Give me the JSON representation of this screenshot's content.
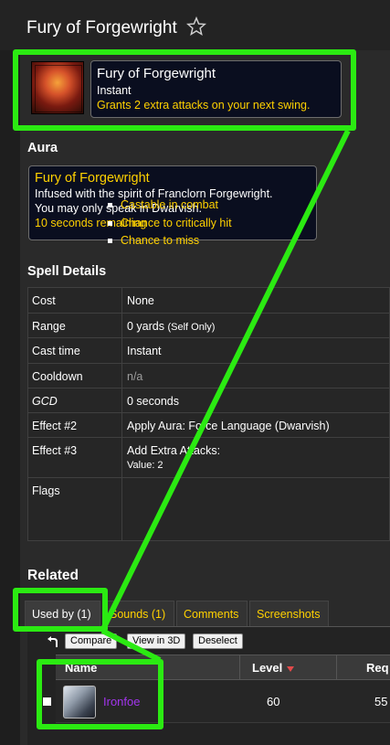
{
  "page": {
    "title": "Fury of Forgewright"
  },
  "spell_tooltip": {
    "name": "Fury of Forgewright",
    "cast": "Instant",
    "description": "Grants 2 extra attacks on your next swing."
  },
  "aura": {
    "heading": "Aura",
    "name": "Fury of Forgewright",
    "line1": "Infused with the spirit of Franclorn Forgewright.",
    "line2": "You may only speak in Dwarvish.",
    "remaining": "10 seconds remaining"
  },
  "spell_details": {
    "heading": "Spell Details",
    "rows": [
      {
        "label": "Cost",
        "value": "None"
      },
      {
        "label": "Range",
        "value": "0 yards",
        "note": "(Self Only)"
      },
      {
        "label": "Cast time",
        "value": "Instant"
      },
      {
        "label": "Cooldown",
        "value": "n/a"
      },
      {
        "label": "GCD",
        "value": "0 seconds"
      },
      {
        "label": "Effect #2",
        "value": "Apply Aura: Force Language (Dwarvish)"
      },
      {
        "label": "Effect #3",
        "value": "Add Extra Attacks:",
        "sub": "Value: 2"
      },
      {
        "label": "Flags"
      }
    ],
    "flags": [
      "Castable in combat",
      "Chance to critically hit",
      "Chance to miss"
    ]
  },
  "related": {
    "heading": "Related",
    "tabs": [
      "Used by (1)",
      "Sounds (1)",
      "Comments",
      "Screenshots"
    ],
    "toolbar": [
      "Compare",
      "View in 3D",
      "Deselect"
    ],
    "columns": [
      "Name",
      "Level",
      "Req"
    ],
    "rows": [
      {
        "name": "Ironfoe",
        "level": "60",
        "req": "55"
      }
    ]
  },
  "colors": {
    "callout": "#2bea12",
    "gold_text": "#ffd100",
    "epic_purple": "#a335ee"
  },
  "icons": [
    "star-icon",
    "spell-icon",
    "back-arrow-icon",
    "sort-desc-icon",
    "item-icon"
  ]
}
